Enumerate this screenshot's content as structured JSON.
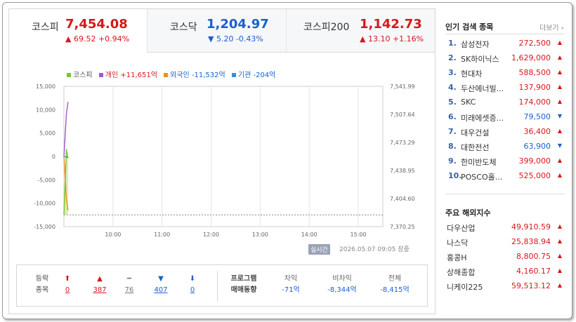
{
  "tabs": [
    {
      "name": "코스피",
      "value": "7,454.08",
      "change": "▲ 69.52 +0.94%",
      "dir": "up"
    },
    {
      "name": "코스닥",
      "value": "1,204.97",
      "change": "▼ 5.20 -0.43%",
      "dir": "down"
    },
    {
      "name": "코스피200",
      "value": "1,142.73",
      "change": "▲ 13.10 +1.16%",
      "dir": "up"
    }
  ],
  "legend": [
    {
      "label": "코스피",
      "color": "#7cc52f"
    },
    {
      "label": "개인 +11,651억",
      "color": "#9b59d0"
    },
    {
      "label": "외국인 -11,532억",
      "color": "#f0901c"
    },
    {
      "label": "기관 -204억",
      "color": "#2f8fe0"
    }
  ],
  "chart_data": {
    "type": "line",
    "x_ticks": [
      "10:00",
      "11:00",
      "12:00",
      "13:00",
      "14:00",
      "15:00"
    ],
    "y_left_ticks": [
      "15,000",
      "10,000",
      "5,000",
      "0",
      "-5,000",
      "-10,000",
      "-15,000"
    ],
    "y_left_range": [
      -15000,
      15000
    ],
    "y_right_ticks": [
      "7,541.99",
      "7,507.64",
      "7,473.29",
      "7,438.95",
      "7,404.60",
      "7,370.25"
    ],
    "y_right_range": [
      7370.25,
      7541.99
    ],
    "series": [
      {
        "name": "코스피",
        "axis": "right",
        "color": "#7cc52f",
        "x": [
          "09:00",
          "09:03",
          "09:05"
        ],
        "y": [
          7384.56,
          7465.0,
          7454.08
        ]
      },
      {
        "name": "개인",
        "axis": "left",
        "color": "#9b59d0",
        "x": [
          "09:00",
          "09:03",
          "09:05"
        ],
        "y": [
          0,
          9000,
          11651
        ]
      },
      {
        "name": "외국인",
        "axis": "left",
        "color": "#f0901c",
        "x": [
          "09:00",
          "09:03",
          "09:05"
        ],
        "y": [
          0,
          -9000,
          -11532
        ]
      },
      {
        "name": "기관",
        "axis": "left",
        "color": "#2f8fe0",
        "x": [
          "09:00",
          "09:03",
          "09:05"
        ],
        "y": [
          0,
          -150,
          -204
        ]
      }
    ],
    "baseline_right": 7384.56
  },
  "realtime_badge": "실시간",
  "datetime": "2026.05.07 09:05 장중",
  "breadth": {
    "label": "등락\n종목",
    "items": [
      {
        "icon": "⬆",
        "count": "0",
        "color": "#d7171b"
      },
      {
        "icon": "▲",
        "count": "387",
        "color": "#d7171b"
      },
      {
        "icon": "━",
        "count": "76",
        "color": "#777777"
      },
      {
        "icon": "▼",
        "count": "407",
        "color": "#1a5fd0"
      },
      {
        "icon": "⬇",
        "count": "0",
        "color": "#1a5fd0"
      }
    ]
  },
  "program": {
    "label": "프로그램\n매매동향",
    "cols": [
      {
        "head": "차익",
        "value": "-71억"
      },
      {
        "head": "비차익",
        "value": "-8,344억"
      },
      {
        "head": "전체",
        "value": "-8,415억"
      }
    ]
  },
  "popular": {
    "title": "인기 검색 종목",
    "more": "더보기",
    "items": [
      {
        "rank": "1.",
        "name": "삼성전자",
        "price": "272,500",
        "dir": "up",
        "arrow": "▲"
      },
      {
        "rank": "2.",
        "name": "SK하이닉스",
        "price": "1,629,000",
        "dir": "up",
        "arrow": "▲"
      },
      {
        "rank": "3.",
        "name": "현대차",
        "price": "588,500",
        "dir": "up",
        "arrow": "▲"
      },
      {
        "rank": "4.",
        "name": "두산에너빌...",
        "price": "137,900",
        "dir": "up",
        "arrow": "▲"
      },
      {
        "rank": "5.",
        "name": "SKC",
        "price": "174,000",
        "dir": "up",
        "arrow": "▲"
      },
      {
        "rank": "6.",
        "name": "미래에셋증...",
        "price": "79,500",
        "dir": "down",
        "arrow": "▼"
      },
      {
        "rank": "7.",
        "name": "대우건설",
        "price": "36,400",
        "dir": "up",
        "arrow": "▲"
      },
      {
        "rank": "8.",
        "name": "대한전선",
        "price": "63,900",
        "dir": "down",
        "arrow": "▼"
      },
      {
        "rank": "9.",
        "name": "한미반도체",
        "price": "399,000",
        "dir": "up",
        "arrow": "▲"
      },
      {
        "rank": "10.",
        "name": "POSCO홀...",
        "price": "525,000",
        "dir": "up",
        "arrow": "▲"
      }
    ]
  },
  "world": {
    "title": "주요 해외지수",
    "items": [
      {
        "name": "다우산업",
        "value": "49,910.59",
        "arrow": "▲"
      },
      {
        "name": "나스닥",
        "value": "25,838.94",
        "arrow": "▲"
      },
      {
        "name": "홍콩H",
        "value": "8,800.75",
        "arrow": "▲"
      },
      {
        "name": "상해종합",
        "value": "4,160.17",
        "arrow": "▲"
      },
      {
        "name": "니케이225",
        "value": "59,513.12",
        "arrow": "▲"
      }
    ]
  }
}
